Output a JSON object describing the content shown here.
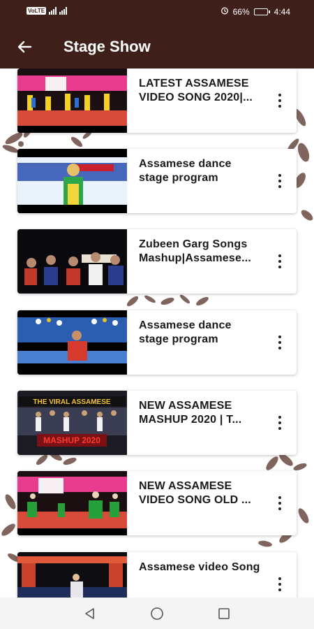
{
  "status_bar": {
    "network_badge": "VoLTE",
    "battery_percent": "66%",
    "battery_level": 0.66,
    "time": "4:44"
  },
  "app_bar": {
    "title": "Stage Show"
  },
  "videos": [
    {
      "title": "LATEST ASSAMESE\nVIDEO SONG 2020|..."
    },
    {
      "title": "Assamese dance\nstage  program"
    },
    {
      "title": "Zubeen Garg Songs\nMashup|Assamese..."
    },
    {
      "title": "Assamese dance\nstage program"
    },
    {
      "title": "NEW ASSAMESE\nMASHUP 2020 | T..."
    },
    {
      "title": "NEW ASSAMESE\nVIDEO SONG OLD ..."
    },
    {
      "title": "Assamese video Song"
    }
  ],
  "thumbnail_text": {
    "viral_banner": "THE VIRAL ASSAMESE",
    "mashup_banner": "MASHUP 2020"
  },
  "colors": {
    "app_bar": "#3e1f19",
    "decoration": "#6b4a42",
    "nav_bar": "#f4f4f4"
  }
}
